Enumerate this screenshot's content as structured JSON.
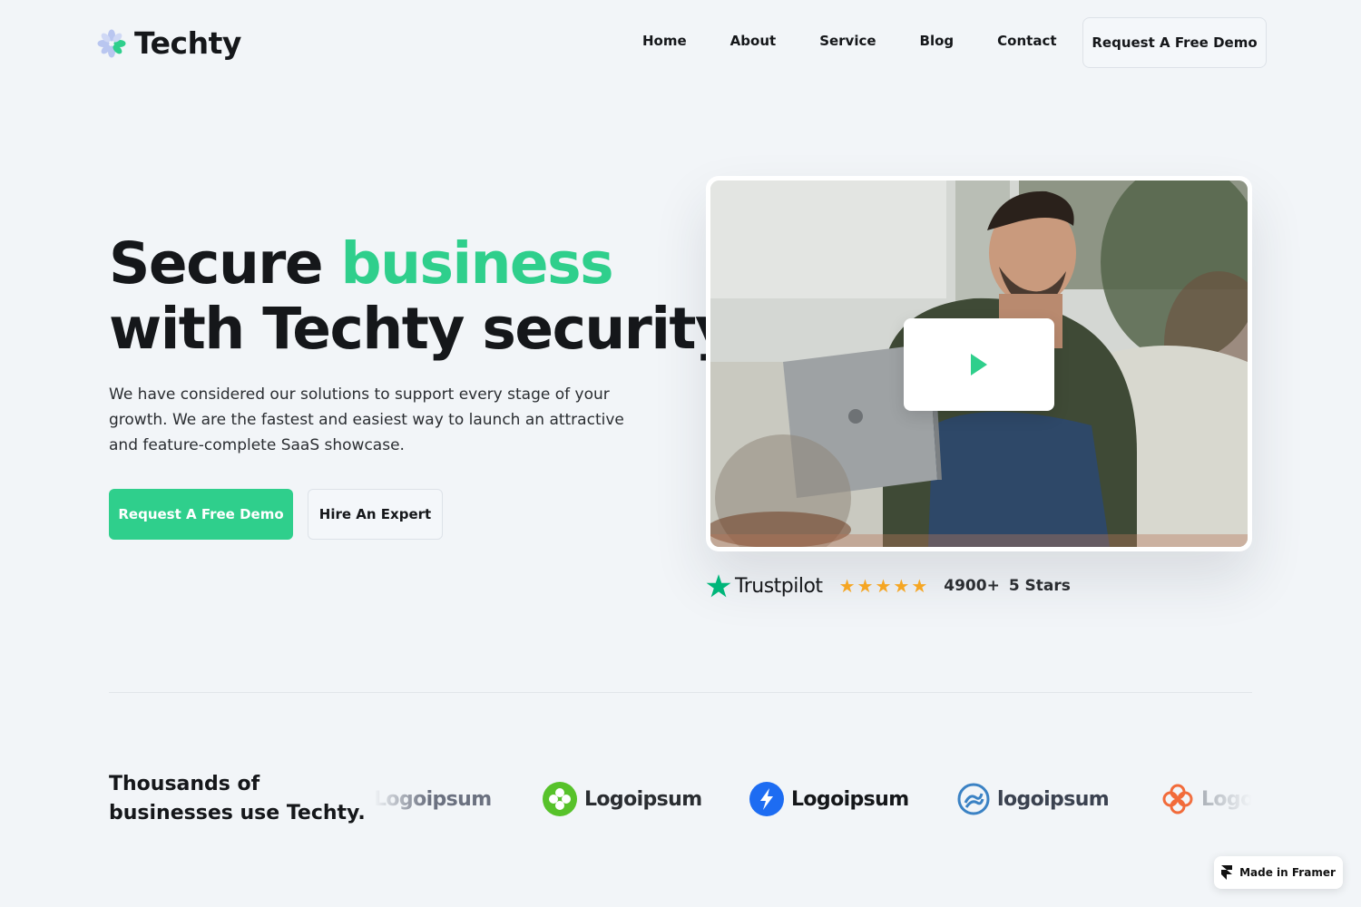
{
  "brand": {
    "name": "Techty"
  },
  "nav": {
    "links": [
      "Home",
      "About",
      "Service",
      "Blog",
      "Contact"
    ],
    "cta": "Request A Free Demo"
  },
  "hero": {
    "title_line1_plain": "Secure ",
    "title_line1_accent": "business",
    "title_line2": "with Techty security.",
    "description": "We have considered our solutions to support every stage of your growth. We are the fastest and easiest way to launch an attractive and feature-complete SaaS showcase.",
    "primary_cta": "Request A Free Demo",
    "secondary_cta": "Hire An Expert"
  },
  "trust": {
    "brand": "Trustpilot",
    "rating_stars": 5,
    "count": "4900+",
    "stars_label": "5 Stars"
  },
  "social_proof": {
    "line1": "Thousands of",
    "line2": "businesses use Techty.",
    "logos": [
      "Logoipsum",
      "Logoipsum",
      "Logoipsum",
      "logoipsum",
      "Logoipsum"
    ]
  },
  "badge": {
    "label": "Made in Framer"
  },
  "colors": {
    "accent": "#2fcf8c",
    "star": "#f5a623",
    "text": "#15171a",
    "background": "#f2f5f8"
  }
}
